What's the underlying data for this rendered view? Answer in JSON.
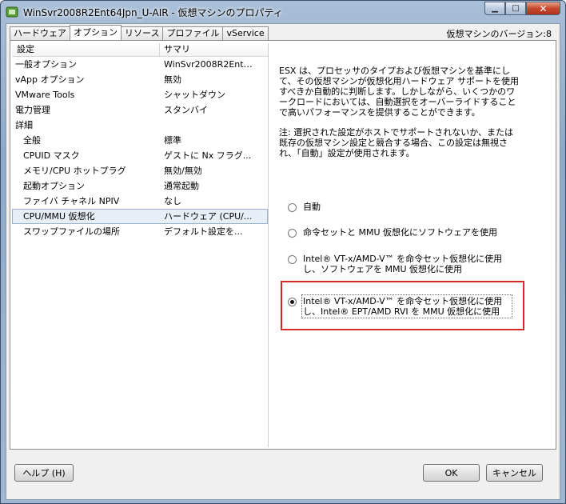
{
  "window": {
    "title": "WinSvr2008R2Ent64Jpn_U-AIR - 仮想マシンのプロパティ",
    "minimize_label": "▁",
    "maximize_label": "□",
    "close_label": "✕"
  },
  "tabs": [
    {
      "label": "ハードウェア",
      "active": false
    },
    {
      "label": "オプション",
      "active": true
    },
    {
      "label": "リソース",
      "active": false
    },
    {
      "label": "プロファイル",
      "active": false
    },
    {
      "label": "vService",
      "active": false
    }
  ],
  "version_label": "仮想マシンのバージョン:8",
  "settings": {
    "headers": {
      "setting": "設定",
      "summary": "サマリ"
    },
    "rows": [
      {
        "name": "一般オプション",
        "summary": "WinSvr2008R2Ent6..."
      },
      {
        "name": "vApp オプション",
        "summary": "無効"
      },
      {
        "name": "VMware Tools",
        "summary": "シャットダウン"
      },
      {
        "name": "電力管理",
        "summary": "スタンバイ"
      },
      {
        "name": "詳細",
        "summary": ""
      },
      {
        "name": "全般",
        "summary": "標準"
      },
      {
        "name": "CPUID マスク",
        "summary": "ゲストに Nx フラグ..."
      },
      {
        "name": "メモリ/CPU ホットプラグ",
        "summary": "無効/無効"
      },
      {
        "name": "起動オプション",
        "summary": "通常起動"
      },
      {
        "name": "ファイバ チャネル NPIV",
        "summary": "なし"
      },
      {
        "name": "CPU/MMU 仮想化",
        "summary": "ハードウェア (CPU/..."
      },
      {
        "name": "スワップファイルの場所",
        "summary": "デフォルト設定を..."
      }
    ]
  },
  "description": {
    "line1": "ESX は、プロセッサのタイプおよび仮想マシンを基準にして、その仮想マシンが仮想化用ハードウェア サポートを使用すべきか自動的に判断します。しかしながら、いくつかのワークロードにおいては、自動選択をオーバーライドすることで高いパフォーマンスを提供することができます。",
    "line2": "注: 選択された設定がホストでサポートされないか、または既存の仮想マシン設定と競合する場合、この設定は無視され、「自動」設定が使用されます。"
  },
  "options": [
    {
      "label": "自動",
      "selected": false
    },
    {
      "label": "命令セットと MMU 仮想化にソフトウェアを使用",
      "selected": false
    },
    {
      "label": "Intel® VT-x/AMD-V™ を命令セット仮想化に使用し、ソフトウェアを MMU 仮想化に使用",
      "selected": false
    },
    {
      "label": "Intel® VT-x/AMD-V™ を命令セット仮想化に使用し、Intel® EPT/AMD RVI を MMU 仮想化に使用",
      "selected": true
    }
  ],
  "buttons": {
    "help": "ヘルプ (H)",
    "ok": "OK",
    "cancel": "キャンセル"
  },
  "colors": {
    "highlight_border": "#d62a2a",
    "selected_row": "#e8eef6"
  }
}
